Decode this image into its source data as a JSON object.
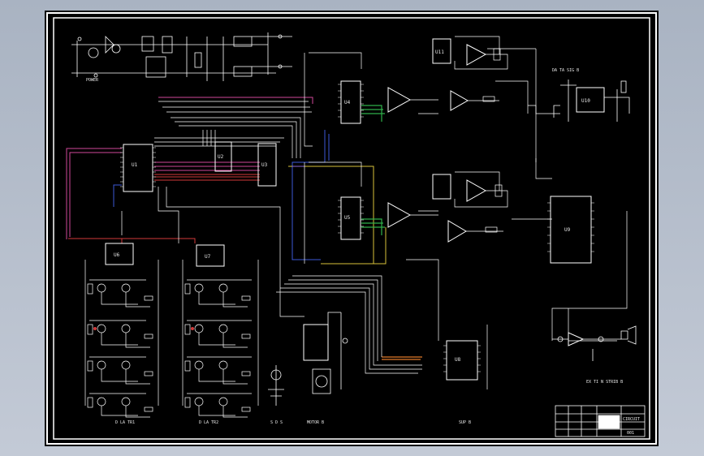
{
  "sheet": {
    "background": "#000000",
    "line_color": "#ffffff",
    "accent_colors": {
      "magenta": "#d1489a",
      "red": "#d23a3a",
      "blue": "#3b59d6",
      "yellow": "#d8c23a",
      "green": "#2fb04a",
      "orange": "#e07a2a",
      "violet": "#8d6ad6"
    }
  },
  "labels": {
    "power": "POWER",
    "chip_u1": "U1",
    "chip_u2": "U2",
    "chip_u3": "U3",
    "chip_u4": "U4",
    "chip_u5": "U5",
    "chip_u6": "U6",
    "chip_u7": "U7",
    "chip_u8": "U8",
    "chip_u9": "U9",
    "chip_ref": "U10",
    "chip_regulator": "U11",
    "label_right_top": "DA TA SIG B",
    "label_right_bottom": "EX TI N STRIB B",
    "label_bottom_left1": "D LA TR1",
    "label_bottom_left2": "D LA TR2",
    "label_bottom_mid1": "S D S",
    "label_bottom_mid2": "MOTOR B",
    "label_bottom_mid3": "SUP B",
    "title_block_name": "CIRCUIT",
    "title_block_no": "001"
  }
}
